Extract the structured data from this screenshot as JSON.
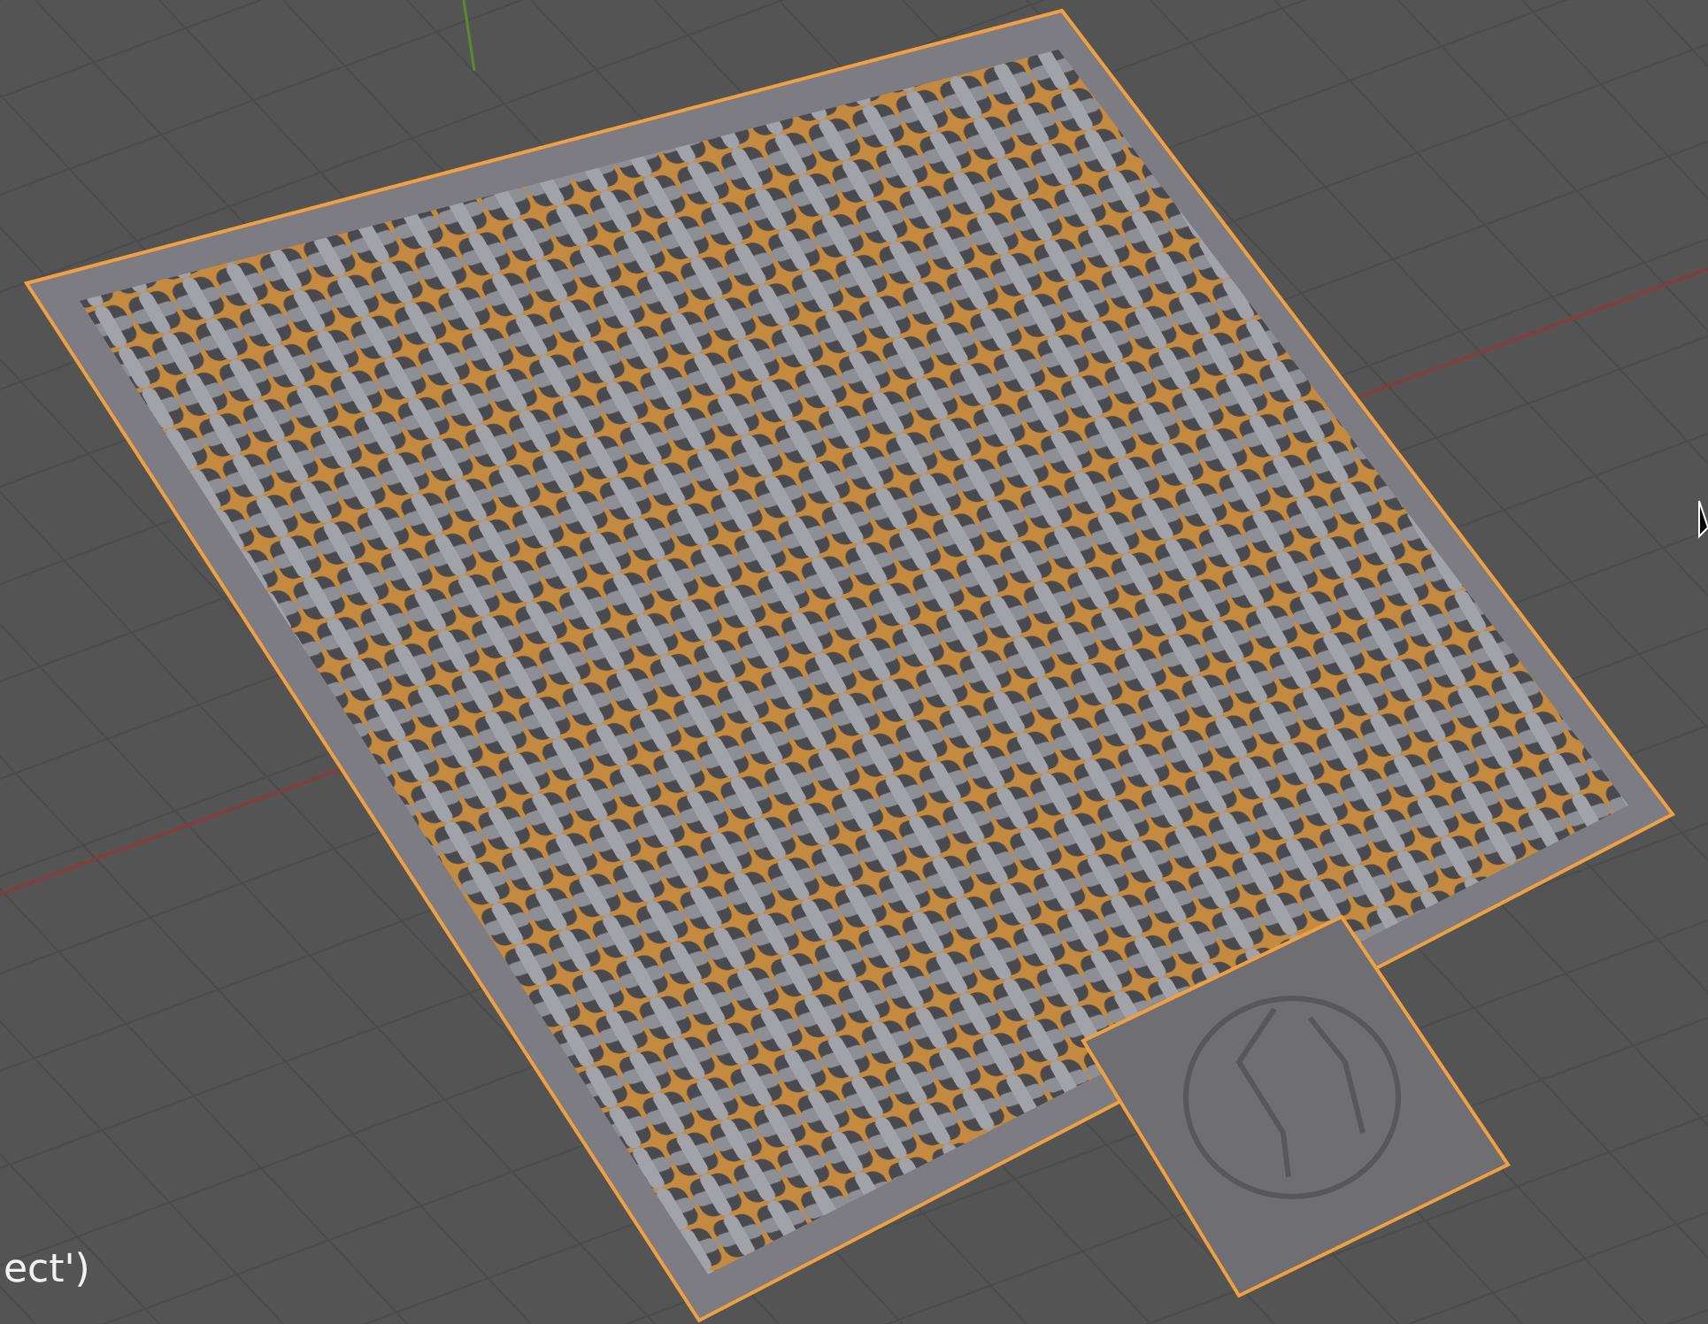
{
  "viewport": {
    "status_text": "ect')"
  }
}
